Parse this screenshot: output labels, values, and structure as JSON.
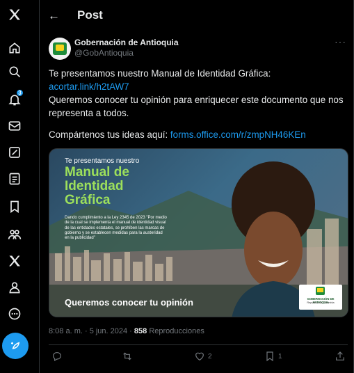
{
  "sidebar": {
    "items": [
      {
        "icon": "x-logo-icon"
      },
      {
        "icon": "home-icon"
      },
      {
        "icon": "search-icon"
      },
      {
        "icon": "notifications-icon",
        "badge": "3"
      },
      {
        "icon": "messages-icon"
      },
      {
        "icon": "grok-icon"
      },
      {
        "icon": "lists-icon"
      },
      {
        "icon": "bookmarks-icon"
      },
      {
        "icon": "communities-icon"
      },
      {
        "icon": "premium-icon"
      },
      {
        "icon": "profile-icon"
      },
      {
        "icon": "more-icon"
      }
    ],
    "compose_icon": "compose-post-icon"
  },
  "header": {
    "back_icon": "←",
    "title": "Post"
  },
  "tweet": {
    "author_name": "Gobernación de Antioquia",
    "author_handle": "@GobAntioquia",
    "more": "···",
    "line1": "Te presentamos nuestro Manual de Identidad Gráfica:",
    "link1": "acortar.link/h2tAW7",
    "line3": "Queremos conocer tu opinión para enriquecer este documento que nos representa a todos.",
    "line4_prefix": "Compártenos tus ideas aquí: ",
    "link2": "forms.office.com/r/zmpNH46KEn",
    "media": {
      "top_text": "Te presentamos nuestro",
      "headline": "Manual de Identidad Gráfica",
      "small_text": "Dando cumplimiento a la Ley 2345 de 2023 \"Por medio de la cual se implementa el manual de identidad visual de las entidades estatales, se prohíben las marcas de gobierno y se establecen medidas para la austeridad en la publicidad\"",
      "bottom_text": "Queremos conocer tu opinión",
      "logo_line1": "GOBERNACIÓN DE ANTIOQUIA",
      "logo_line2": "República de Colombia"
    },
    "time": "8:08 a. m. · 5 jun. 2024 · ",
    "views_count": "858",
    "views_label": " Reproducciones",
    "actions": {
      "reply_count": "",
      "retweet_count": "",
      "like_count": "2",
      "bookmark_count": "1"
    }
  },
  "colors": {
    "accent": "#1d9bf0",
    "background": "#000000",
    "muted": "#71767b",
    "headline_green": "#9de05b"
  }
}
